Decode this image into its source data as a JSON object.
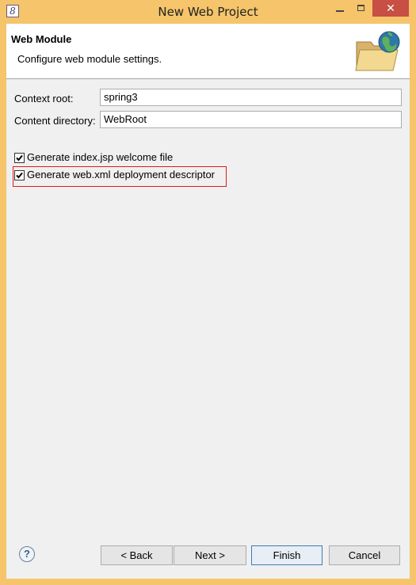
{
  "window": {
    "title": "New Web Project",
    "app_icon_glyph": "8",
    "close_glyph": "✕"
  },
  "header": {
    "title": "Web Module",
    "description": "Configure web module settings.",
    "icon": "web-folder-globe-icon"
  },
  "form": {
    "context_root": {
      "label": "Context root:",
      "value": "spring3"
    },
    "content_directory": {
      "label": "Content directory:",
      "value": "WebRoot"
    },
    "options": [
      {
        "label": "Generate index.jsp welcome file",
        "checked": true
      },
      {
        "label": "Generate web.xml deployment descriptor",
        "checked": true
      }
    ]
  },
  "footer": {
    "help_glyph": "?",
    "back_label": "< Back",
    "next_label": "Next >",
    "finish_label": "Finish",
    "cancel_label": "Cancel"
  },
  "colors": {
    "frame": "#f5c46b",
    "close_button": "#c74f43",
    "highlight": "#e0191d"
  }
}
